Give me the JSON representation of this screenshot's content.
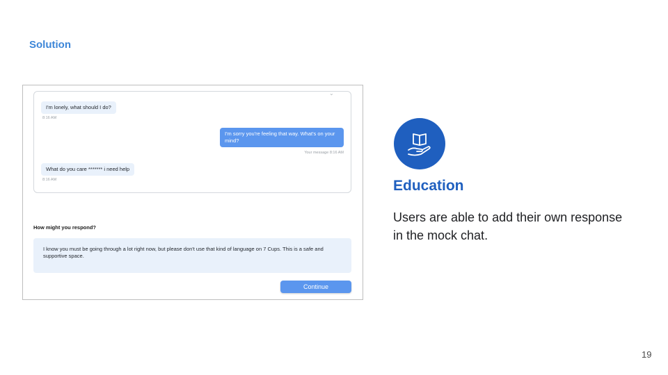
{
  "slide": {
    "section_label": "Solution",
    "page_number": "19"
  },
  "chat": {
    "messages": [
      {
        "text": "I'm lonely, what should I do?",
        "meta": "8:16 AM",
        "from": "other"
      },
      {
        "text": "I'm sorry you're feeling that way. What's on your mind?",
        "meta": "Your message 8:16 AM",
        "from": "me"
      },
      {
        "text": "What do you care ******* i need help",
        "meta": "8:16 AM",
        "from": "other"
      }
    ]
  },
  "respond": {
    "prompt": "How might you respond?",
    "response_text": "I know you must be going through a lot right now, but please don't use that kind of language on 7 Cups. This is a safe and supportive space.",
    "continue_label": "Continue"
  },
  "feature": {
    "icon": "book-in-hand-icon",
    "title": "Education",
    "description": "Users are able to add their own response in the mock chat."
  },
  "colors": {
    "accent_light": "#3d86d8",
    "accent_dark": "#1f5fbf",
    "bubble_out": "#5b96ee",
    "bubble_in": "#e9f1fb"
  }
}
